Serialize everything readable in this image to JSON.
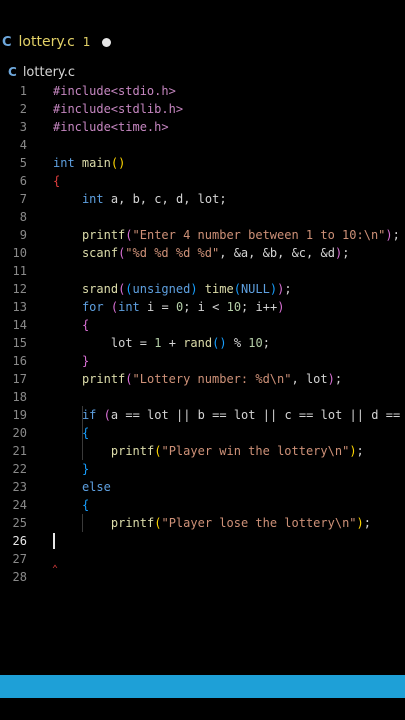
{
  "tab": {
    "lang_icon": "C",
    "filename": "lottery.c",
    "badge": "1"
  },
  "breadcrumb": {
    "lang_icon": "C",
    "filename": "lottery.c"
  },
  "editor": {
    "active_line": 26,
    "lines": [
      {
        "n": "1",
        "code": "#include<stdio.h>"
      },
      {
        "n": "2",
        "code": "#include<stdlib.h>"
      },
      {
        "n": "3",
        "code": "#include<time.h>"
      },
      {
        "n": "4",
        "code": ""
      },
      {
        "n": "5",
        "code": "int main()"
      },
      {
        "n": "6",
        "code": "{"
      },
      {
        "n": "7",
        "code": "    int a, b, c, d, lot;"
      },
      {
        "n": "8",
        "code": ""
      },
      {
        "n": "9",
        "code": "    printf(\"Enter 4 number between 1 to 10:\\n\");"
      },
      {
        "n": "10",
        "code": "    scanf(\"%d %d %d %d\", &a, &b, &c, &d);"
      },
      {
        "n": "11",
        "code": ""
      },
      {
        "n": "12",
        "code": "    srand((unsigned) time(NULL));"
      },
      {
        "n": "13",
        "code": "    for (int i = 0; i < 10; i++)"
      },
      {
        "n": "14",
        "code": "    {"
      },
      {
        "n": "15",
        "code": "        lot = 1 + rand() % 10;"
      },
      {
        "n": "16",
        "code": "    }"
      },
      {
        "n": "17",
        "code": "    printf(\"Lottery number: %d\\n\", lot);"
      },
      {
        "n": "18",
        "code": ""
      },
      {
        "n": "19",
        "code": "    if (a == lot || b == lot || c == lot || d =="
      },
      {
        "n": "20",
        "code": "    {"
      },
      {
        "n": "21",
        "code": "        printf(\"Player win the lottery\\n\");"
      },
      {
        "n": "22",
        "code": "    }"
      },
      {
        "n": "23",
        "code": "    else"
      },
      {
        "n": "24",
        "code": "    {"
      },
      {
        "n": "25",
        "code": "        printf(\"Player lose the lottery\\n\");"
      },
      {
        "n": "26",
        "code": ""
      },
      {
        "n": "27",
        "code": ""
      },
      {
        "n": "28",
        "code": ""
      }
    ]
  },
  "colors": {
    "background": "#000000",
    "statusbar": "#1ea0d7",
    "tab_modified": "#e2d167",
    "keyword": "#5ea0e0",
    "function": "#dcdcaa",
    "string": "#ce9178",
    "preprocessor": "#c586c0"
  }
}
